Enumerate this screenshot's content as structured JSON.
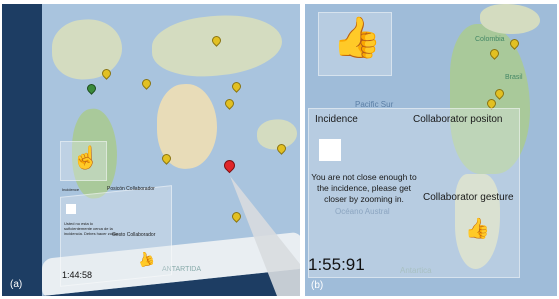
{
  "panel_a": {
    "tag": "(a)",
    "timer": "1:44:58",
    "labels": {
      "incidence": "Incidence",
      "collaborator_position": "Posicón Collaborador",
      "collaborator_gesture": "Gesto Collaborador",
      "warning": "Usted no esta lo suficientemente cerca de la incidencia. Debes hacer zoom."
    },
    "map_labels": {
      "antarctica": "ANTARTIDA"
    },
    "icons": [
      "hand-pointing-up-icon",
      "hand-thumbs-up-icon",
      "map-pin-icon"
    ]
  },
  "panel_b": {
    "tag": "(b)",
    "timer": "1:55:91",
    "labels": {
      "incidence": "Incidence",
      "collaborator_position": "Collaborator positon",
      "collaborator_gesture": "Collaborator gesture",
      "warning": "You are not close enough to the incidence, please get closer by zooming in."
    },
    "map_labels": {
      "pacific": "Pacific Sur",
      "south_ocean": "Océano Austral",
      "antarctica": "Antartica",
      "colombia": "Colombia",
      "brazil": "Brasil"
    },
    "icons": [
      "hand-thumbs-up-icon"
    ]
  },
  "colors": {
    "ocean": "#9fbcd9",
    "land": "#d4dcc0",
    "pin_yellow": "#e2c022",
    "pin_red": "#e0262a",
    "white_square": "#ffffff"
  }
}
